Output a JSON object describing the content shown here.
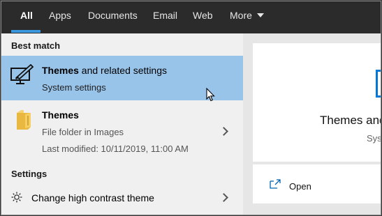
{
  "tabs": [
    {
      "label": "All"
    },
    {
      "label": "Apps"
    },
    {
      "label": "Documents"
    },
    {
      "label": "Email"
    },
    {
      "label": "Web"
    },
    {
      "label": "More"
    }
  ],
  "best_match": {
    "heading": "Best match",
    "title_bold": "Themes",
    "title_rest": " and related settings",
    "subtitle": "System settings"
  },
  "folder": {
    "title": "Themes",
    "subtitle": "File folder in Images",
    "modified": "Last modified: 10/11/2019, 11:00 AM"
  },
  "settings": {
    "heading": "Settings",
    "item": "Change high contrast theme"
  },
  "preview": {
    "title": "Themes and",
    "subtitle": "Syste",
    "open_label": "Open"
  },
  "colors": {
    "accent": "#3a96dd",
    "highlight": "#99c4ea",
    "topbar": "#2b2b2b"
  }
}
